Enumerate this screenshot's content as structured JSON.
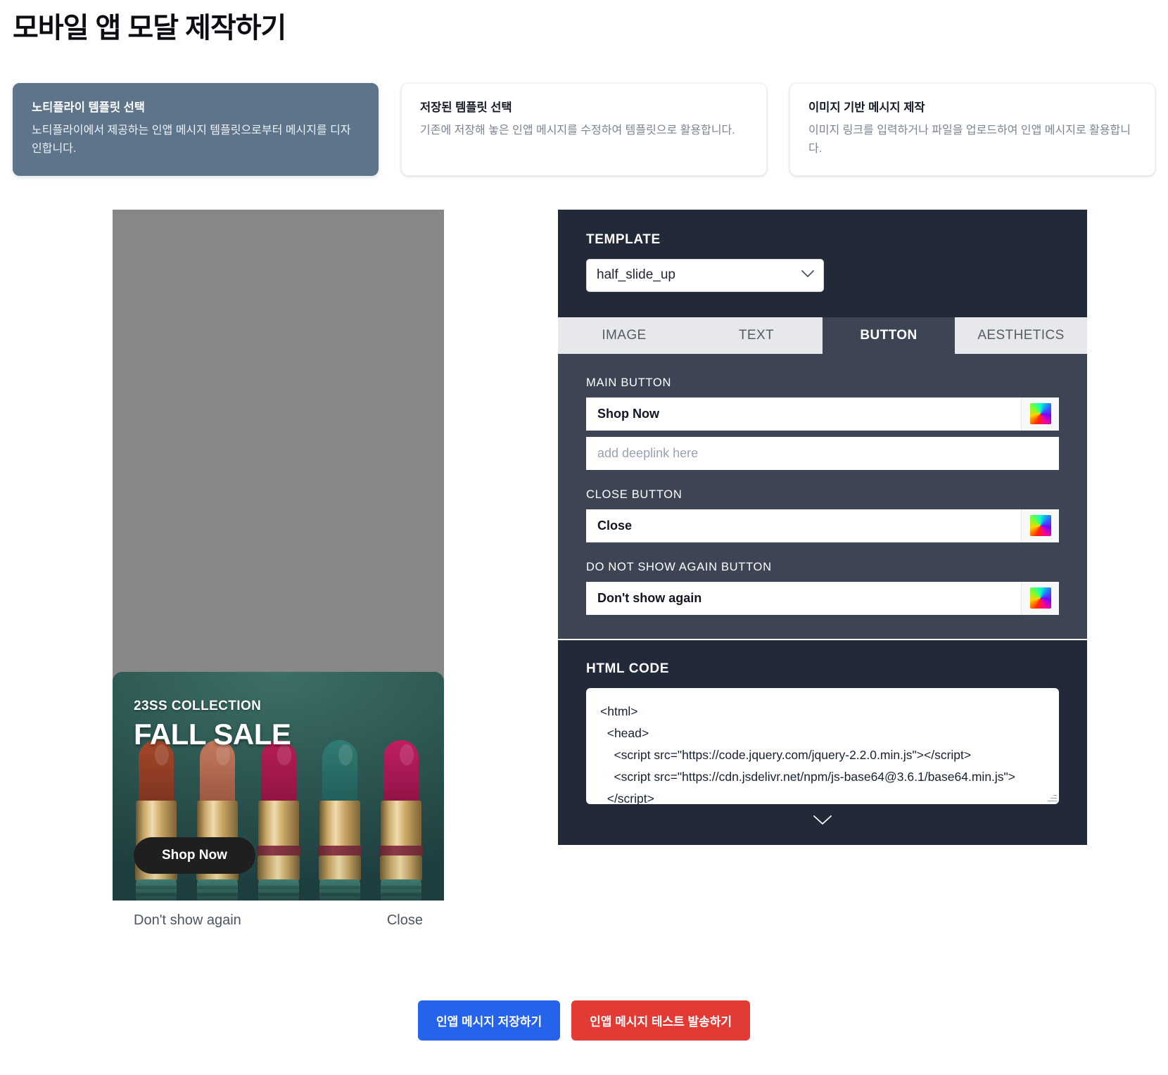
{
  "page_title": "모바일 앱 모달 제작하기",
  "option_cards": [
    {
      "title": "노티플라이 템플릿 선택",
      "desc": "노티플라이에서 제공하는 인앱 메시지 템플릿으로부터 메시지를 디자인합니다.",
      "selected": true
    },
    {
      "title": "저장된 템플릿 선택",
      "desc": "기존에 저장해 놓은 인앱 메시지를 수정하여 템플릿으로 활용합니다.",
      "selected": false
    },
    {
      "title": "이미지 기반 메시지 제작",
      "desc": "이미지 링크를 입력하거나 파일을 업로드하여 인앱 메시지로 활용합니다.",
      "selected": false
    }
  ],
  "preview": {
    "collection_label": "23SS COLLECTION",
    "sale_label": "FALL SALE",
    "shop_now_label": "Shop Now",
    "dont_show_again_label": "Don't show again",
    "close_label": "Close"
  },
  "editor": {
    "template_section_label": "TEMPLATE",
    "template_value": "half_slide_up",
    "tabs": [
      {
        "label": "IMAGE",
        "active": false
      },
      {
        "label": "TEXT",
        "active": false
      },
      {
        "label": "BUTTON",
        "active": true
      },
      {
        "label": "AESTHETICS",
        "active": false
      }
    ],
    "main_button": {
      "label": "MAIN BUTTON",
      "value": "Shop Now",
      "deeplink_placeholder": "add deeplink here",
      "deeplink_value": ""
    },
    "close_button": {
      "label": "CLOSE BUTTON",
      "value": "Close"
    },
    "do_not_show_again_button": {
      "label": "DO NOT SHOW AGAIN BUTTON",
      "value": "Don't show again"
    },
    "html_code": {
      "label": "HTML CODE",
      "content": "<html>\n  <head>\n    <script src=\"https://code.jquery.com/jquery-2.2.0.min.js\"></script>\n    <script src=\"https://cdn.jsdelivr.net/npm/js-base64@3.6.1/base64.min.js\">\n  </script>"
    }
  },
  "actions": {
    "save_label": "인앱 메시지 저장하기",
    "test_label": "인앱 메시지 테스트 발송하기"
  },
  "colors": {
    "selected_card": "#5d748a",
    "panel_dark": "#222938",
    "panel_mid": "#3d4554",
    "tab_bar": "#e6e8ec",
    "save_button": "#2563eb",
    "test_button": "#e23a34"
  }
}
